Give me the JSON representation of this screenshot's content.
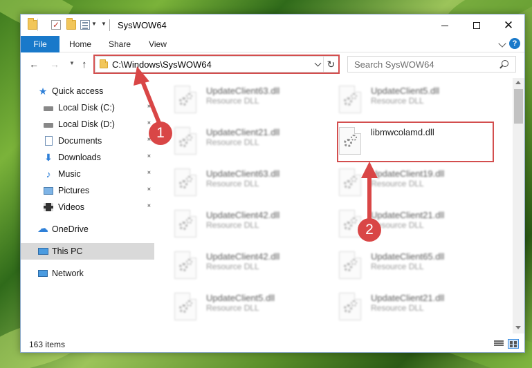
{
  "window": {
    "title": "SysWOW64"
  },
  "ribbon": {
    "tabs": [
      "File",
      "Home",
      "Share",
      "View"
    ],
    "help": "?"
  },
  "address": {
    "path": "C:\\Windows\\SysWOW64"
  },
  "search": {
    "placeholder": "Search SysWOW64"
  },
  "sidebar": {
    "items": [
      {
        "label": "Quick access",
        "icon": "star-icon"
      },
      {
        "label": "Local Disk (C:)",
        "icon": "drive-icon",
        "pinned": true
      },
      {
        "label": "Local Disk (D:)",
        "icon": "drive-icon",
        "pinned": true
      },
      {
        "label": "Documents",
        "icon": "documents-icon",
        "pinned": true
      },
      {
        "label": "Downloads",
        "icon": "downloads-icon",
        "pinned": true
      },
      {
        "label": "Music",
        "icon": "music-icon",
        "pinned": true
      },
      {
        "label": "Pictures",
        "icon": "pictures-icon",
        "pinned": true
      },
      {
        "label": "Videos",
        "icon": "videos-icon",
        "pinned": true
      },
      {
        "label": "OneDrive",
        "icon": "cloud-icon"
      },
      {
        "label": "This PC",
        "icon": "computer-icon",
        "selected": true
      },
      {
        "label": "Network",
        "icon": "network-icon"
      }
    ]
  },
  "files": [
    {
      "name": "UpdateClient63.dll",
      "type": "Resource DLL",
      "blurred": true
    },
    {
      "name": "UpdateClient5.dll",
      "type": "Resource DLL",
      "blurred": true
    },
    {
      "name": "UpdateClient21.dll",
      "type": "Resource DLL",
      "blurred": true
    },
    {
      "name": "libmwcolamd.dll",
      "type": "",
      "blurred": false
    },
    {
      "name": "UpdateClient63.dll",
      "type": "Resource DLL",
      "blurred": true
    },
    {
      "name": "UpdateClient19.dll",
      "type": "Resource DLL",
      "blurred": true
    },
    {
      "name": "UpdateClient42.dll",
      "type": "Resource DLL",
      "blurred": true
    },
    {
      "name": "UpdateClient21.dll",
      "type": "Resource DLL",
      "blurred": true
    },
    {
      "name": "UpdateClient42.dll",
      "type": "Resource DLL",
      "blurred": true
    },
    {
      "name": "UpdateClient65.dll",
      "type": "Resource DLL",
      "blurred": true
    },
    {
      "name": "UpdateClient5.dll",
      "type": "Resource DLL",
      "blurred": true
    },
    {
      "name": "UpdateClient21.dll",
      "type": "Resource DLL",
      "blurred": true
    }
  ],
  "status": {
    "item_count": "163 items"
  },
  "annotations": {
    "step1": "1",
    "step2": "2",
    "color": "#d94646"
  }
}
